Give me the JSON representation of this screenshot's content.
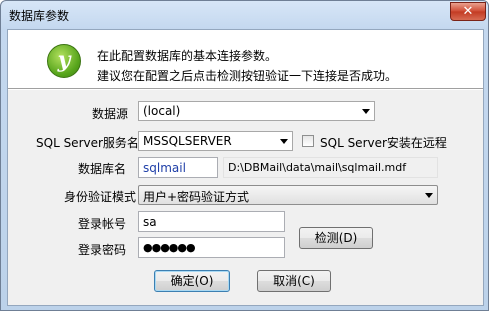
{
  "window": {
    "title": "数据库参数",
    "close_glyph": "✕"
  },
  "header": {
    "logo_glyph": "y",
    "line1": "在此配置数据库的基本连接参数。",
    "line2": "建议您在配置之后点击检测按钮验证一下连接是否成功。"
  },
  "form": {
    "datasource_label": "数据源",
    "datasource_value": "(local)",
    "service_label": "SQL Server服务名",
    "service_value": "MSSQLSERVER",
    "remote_label": "SQL Server安装在远程",
    "remote_checked": false,
    "dbname_label": "数据库名",
    "dbname_value": "sqlmail",
    "dbpath_value": "D:\\DBMail\\data\\mail\\sqlmail.mdf",
    "auth_label": "身份验证模式",
    "auth_value": "用户+密码验证方式",
    "account_label": "登录帐号",
    "account_value": "sa",
    "password_label": "登录密码",
    "password_value": "●●●●●●"
  },
  "buttons": {
    "test": "检测(D)",
    "ok": "确定(O)",
    "cancel": "取消(C)"
  },
  "colors": {
    "dbname_text": "#1f3fa8",
    "logo": "#6db52c"
  }
}
